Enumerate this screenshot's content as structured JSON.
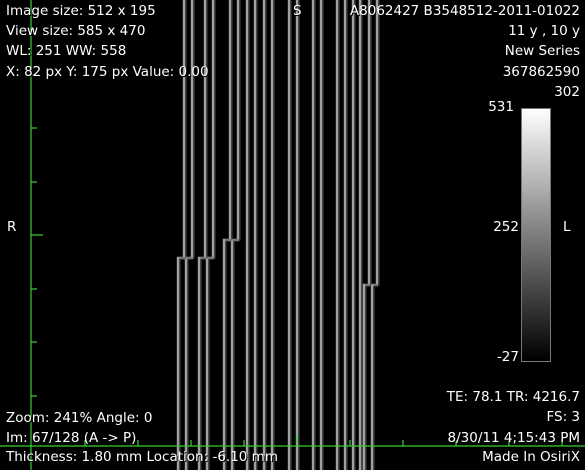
{
  "overlay": {
    "top_left": {
      "image_size": "Image size: 512 x 195",
      "view_size": "View size: 585 x 470",
      "wl_ww": "WL: 251 WW: 558",
      "cursor": "X: 82 px Y: 175 px Value: 0.00"
    },
    "top_right": {
      "orientation_top": "S",
      "patient_id": "A8062427 B3548512-2011-01022",
      "age": "11 y ,  10 y",
      "series_name": "New Series",
      "study_id": "367862590",
      "series_number": "302"
    },
    "side": {
      "left": "R",
      "right": "L"
    },
    "colorbar": {
      "max": "531",
      "mid": "252",
      "min": "-27"
    },
    "bottom_right": {
      "te_tr": "TE:  78.1 TR:  4216.7",
      "fs": "FS:  3",
      "datetime": "8/30/11 4;15:43 PM",
      "made_in": "Made In OsiriX"
    },
    "bottom_left": {
      "zoom_angle": "Zoom: 241% Angle: 0",
      "image_index": "Im: 67/128  (A -> P)",
      "thickness_location": "Thickness: 1.80 mm Location: -6.10 mm"
    }
  },
  "colors": {
    "background": "#000000",
    "text": "#ffffff",
    "ruler": "#34d134",
    "stripes": "#bdbdbd"
  }
}
